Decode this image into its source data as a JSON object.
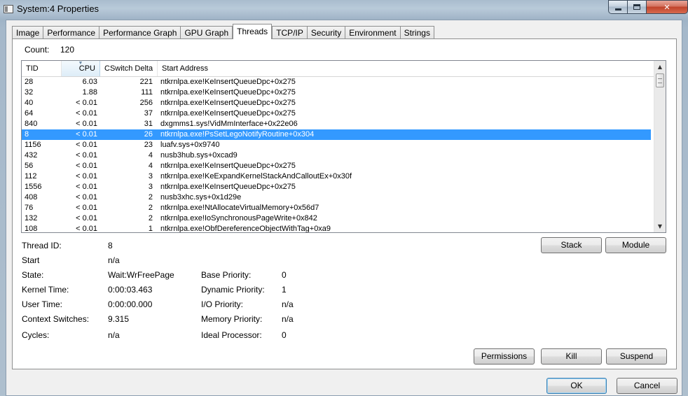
{
  "window": {
    "title": "System:4 Properties"
  },
  "tabs": [
    "Image",
    "Performance",
    "Performance Graph",
    "GPU Graph",
    "Threads",
    "TCP/IP",
    "Security",
    "Environment",
    "Strings"
  ],
  "active_tab": "Threads",
  "count": {
    "label": "Count:",
    "value": "120"
  },
  "columns": {
    "tid": "TID",
    "cpu": "CPU",
    "cswitch": "CSwitch Delta",
    "start": "Start Address"
  },
  "threads": [
    {
      "tid": "28",
      "cpu": "6.03",
      "cs": "221",
      "start": "ntkrnlpa.exe!KeInsertQueueDpc+0x275"
    },
    {
      "tid": "32",
      "cpu": "1.88",
      "cs": "111",
      "start": "ntkrnlpa.exe!KeInsertQueueDpc+0x275"
    },
    {
      "tid": "40",
      "cpu": "< 0.01",
      "cs": "256",
      "start": "ntkrnlpa.exe!KeInsertQueueDpc+0x275"
    },
    {
      "tid": "64",
      "cpu": "< 0.01",
      "cs": "37",
      "start": "ntkrnlpa.exe!KeInsertQueueDpc+0x275"
    },
    {
      "tid": "840",
      "cpu": "< 0.01",
      "cs": "31",
      "start": "dxgmms1.sys!VidMmInterface+0x22e06"
    },
    {
      "tid": "8",
      "cpu": "< 0.01",
      "cs": "26",
      "start": "ntkrnlpa.exe!PsSetLegoNotifyRoutine+0x304"
    },
    {
      "tid": "1156",
      "cpu": "< 0.01",
      "cs": "23",
      "start": "luafv.sys+0x9740"
    },
    {
      "tid": "432",
      "cpu": "< 0.01",
      "cs": "4",
      "start": "nusb3hub.sys+0xcad9"
    },
    {
      "tid": "56",
      "cpu": "< 0.01",
      "cs": "4",
      "start": "ntkrnlpa.exe!KeInsertQueueDpc+0x275"
    },
    {
      "tid": "112",
      "cpu": "< 0.01",
      "cs": "3",
      "start": "ntkrnlpa.exe!KeExpandKernelStackAndCalloutEx+0x30f"
    },
    {
      "tid": "1556",
      "cpu": "< 0.01",
      "cs": "3",
      "start": "ntkrnlpa.exe!KeInsertQueueDpc+0x275"
    },
    {
      "tid": "408",
      "cpu": "< 0.01",
      "cs": "2",
      "start": "nusb3xhc.sys+0x1d29e"
    },
    {
      "tid": "76",
      "cpu": "< 0.01",
      "cs": "2",
      "start": "ntkrnlpa.exe!NtAllocateVirtualMemory+0x56d7"
    },
    {
      "tid": "132",
      "cpu": "< 0.01",
      "cs": "2",
      "start": "ntkrnlpa.exe!IoSynchronousPageWrite+0x842"
    },
    {
      "tid": "108",
      "cpu": "< 0.01",
      "cs": "1",
      "start": "ntkrnlpa.exe!ObfDereferenceObjectWithTag+0xa9"
    }
  ],
  "selected_tid": "8",
  "details": {
    "thread_id": {
      "label": "Thread ID:",
      "value": "8"
    },
    "start": {
      "label": "Start",
      "value": "n/a"
    },
    "state": {
      "label": "State:",
      "value": "Wait:WrFreePage"
    },
    "kernel_time": {
      "label": "Kernel Time:",
      "value": "0:00:03.463"
    },
    "user_time": {
      "label": "User Time:",
      "value": "0:00:00.000"
    },
    "context_switches": {
      "label": "Context Switches:",
      "value": "9.315"
    },
    "cycles": {
      "label": "Cycles:",
      "value": "n/a"
    },
    "base_priority": {
      "label": "Base Priority:",
      "value": "0"
    },
    "dynamic_priority": {
      "label": "Dynamic Priority:",
      "value": "1"
    },
    "io_priority": {
      "label": "I/O Priority:",
      "value": "n/a"
    },
    "memory_priority": {
      "label": "Memory Priority:",
      "value": "n/a"
    },
    "ideal_processor": {
      "label": "Ideal Processor:",
      "value": "0"
    }
  },
  "buttons": {
    "stack": "Stack",
    "module": "Module",
    "permissions": "Permissions",
    "kill": "Kill",
    "suspend": "Suspend",
    "ok": "OK",
    "cancel": "Cancel"
  },
  "colors": {
    "selection": "#3399ff",
    "close_button": "#c0432b"
  }
}
